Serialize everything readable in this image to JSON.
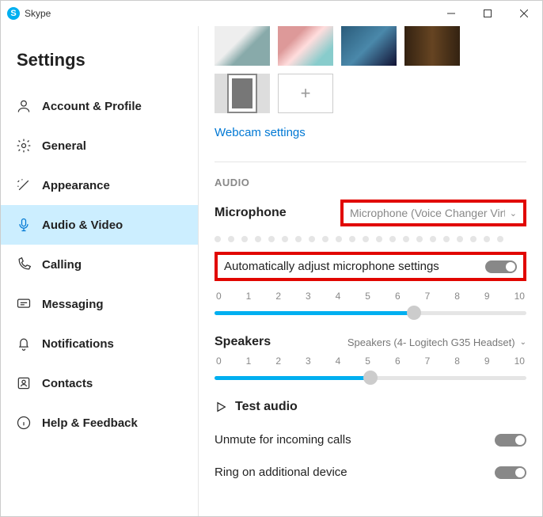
{
  "window": {
    "title": "Skype"
  },
  "sidebar": {
    "heading": "Settings",
    "items": [
      {
        "label": "Account & Profile"
      },
      {
        "label": "General"
      },
      {
        "label": "Appearance"
      },
      {
        "label": "Audio & Video"
      },
      {
        "label": "Calling"
      },
      {
        "label": "Messaging"
      },
      {
        "label": "Notifications"
      },
      {
        "label": "Contacts"
      },
      {
        "label": "Help & Feedback"
      }
    ],
    "active_index": 3
  },
  "content": {
    "webcam_link": "Webcam settings",
    "audio_section": "AUDIO",
    "microphone": {
      "label": "Microphone",
      "selected": "Microphone (Voice Changer Virtua"
    },
    "auto_adjust": {
      "label": "Automatically adjust microphone settings",
      "on": true
    },
    "mic_slider": {
      "min": 0,
      "max": 10,
      "value": 6.4,
      "scale": [
        "0",
        "1",
        "2",
        "3",
        "4",
        "5",
        "6",
        "7",
        "8",
        "9",
        "10"
      ]
    },
    "speakers": {
      "label": "Speakers",
      "selected": "Speakers (4- Logitech G35 Headset)"
    },
    "spk_slider": {
      "min": 0,
      "max": 10,
      "value": 5,
      "scale": [
        "0",
        "1",
        "2",
        "3",
        "4",
        "5",
        "6",
        "7",
        "8",
        "9",
        "10"
      ]
    },
    "test_audio": "Test audio",
    "unmute": {
      "label": "Unmute for incoming calls",
      "on": true
    },
    "ring": {
      "label": "Ring on additional device",
      "on": true
    }
  }
}
